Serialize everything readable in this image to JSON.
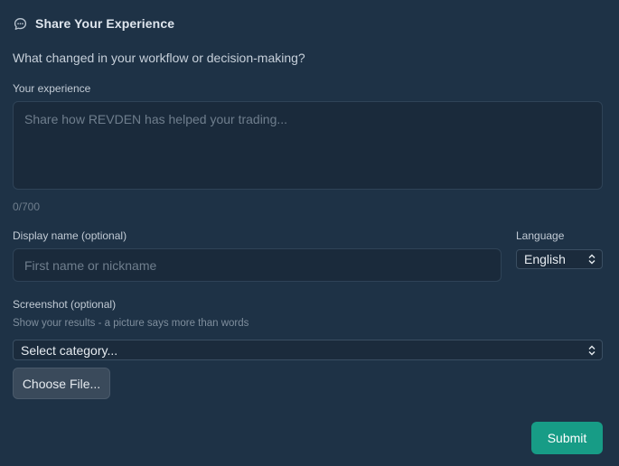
{
  "header": {
    "title": "Share Your Experience",
    "icon": "chat-bubble-icon"
  },
  "question": "What changed in your workflow or decision-making?",
  "experience": {
    "label": "Your experience",
    "placeholder": "Share how REVDEN has helped your trading...",
    "value": "",
    "counter": "0/700"
  },
  "display_name": {
    "label": "Display name (optional)",
    "placeholder": "First name or nickname",
    "value": ""
  },
  "language": {
    "label": "Language",
    "selected": "English"
  },
  "screenshot": {
    "label": "Screenshot (optional)",
    "hint": "Show your results - a picture says more than words",
    "category_selected": "Select category...",
    "file_button": "Choose File..."
  },
  "submit_label": "Submit",
  "colors": {
    "background": "#1e3246",
    "field": "#1a2a3b",
    "accent": "#179c86",
    "file_button": "#3a4a5b"
  }
}
